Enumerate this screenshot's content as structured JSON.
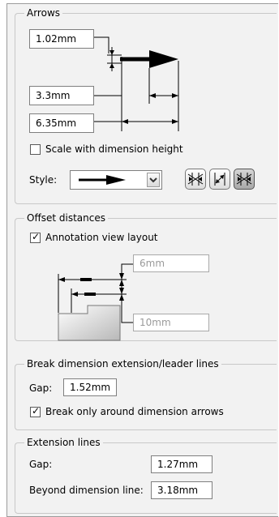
{
  "arrows": {
    "legend": "Arrows",
    "arrow_width": "1.02mm",
    "arrow_height": "3.3mm",
    "arrow_length": "6.35mm",
    "scale_label": "Scale with dimension height",
    "scale_checked": false,
    "style_label": "Style:"
  },
  "offset": {
    "legend": "Offset distances",
    "annotation_label": "Annotation view layout",
    "annotation_checked": true,
    "dist1": "6mm",
    "dist2": "10mm"
  },
  "break": {
    "legend": "Break dimension extension/leader lines",
    "gap_label": "Gap:",
    "gap_value": "1.52mm",
    "break_label": "Break only around dimension arrows",
    "break_checked": true
  },
  "extension": {
    "legend": "Extension lines",
    "gap_label": "Gap:",
    "gap_value": "1.27mm",
    "beyond_label": "Beyond dimension line:",
    "beyond_value": "3.18mm"
  },
  "icons": [
    "arrows-outside-icon",
    "arrows-inside-icon",
    "smart-arrows-icon"
  ]
}
